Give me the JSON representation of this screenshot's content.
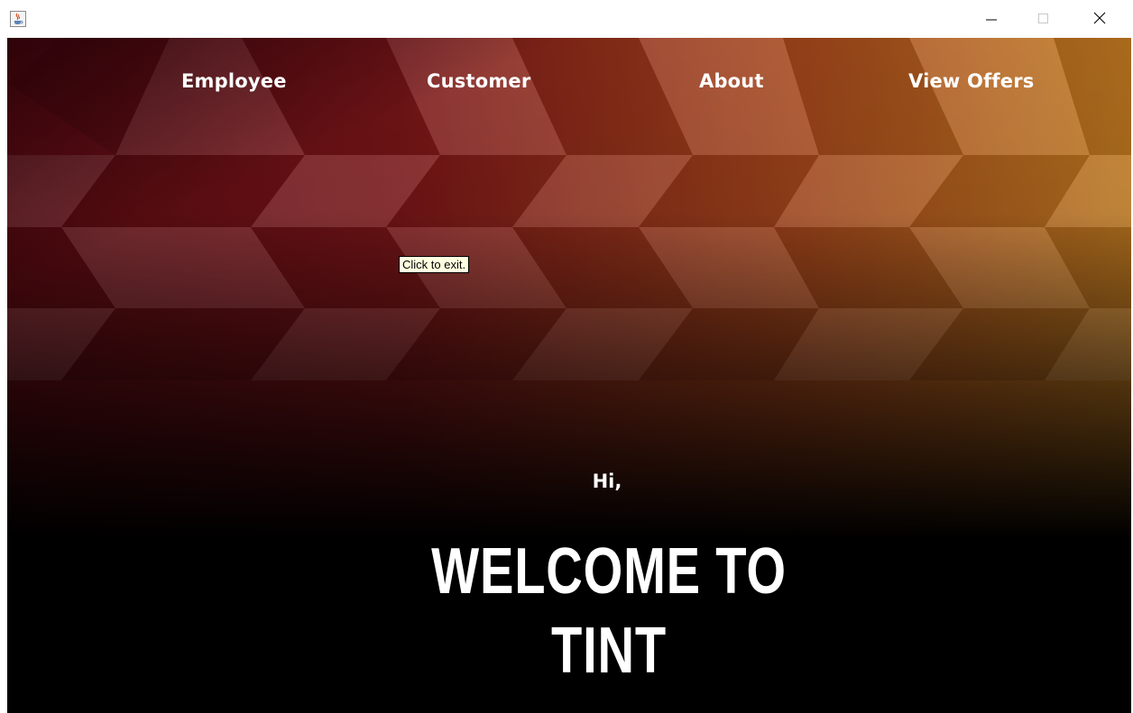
{
  "titlebar": {
    "icon": "java-coffee-icon",
    "minimize_icon": "minimize-icon",
    "maximize_icon": "maximize-icon",
    "close_icon": "close-icon"
  },
  "nav": {
    "items": [
      {
        "label": "Employee"
      },
      {
        "label": "Customer"
      },
      {
        "label": "About"
      },
      {
        "label": "View Offers"
      }
    ]
  },
  "tooltip": {
    "text": "Click to exit."
  },
  "hero": {
    "greeting": "Hi,",
    "line1": "WELCOME TO",
    "line2": "TINT"
  },
  "colors": {
    "bg_red": "#7a1418",
    "bg_orange": "#b5651d",
    "bg_bottom": "#000000",
    "text": "#ffffff",
    "tooltip_bg": "#ffffe1"
  }
}
